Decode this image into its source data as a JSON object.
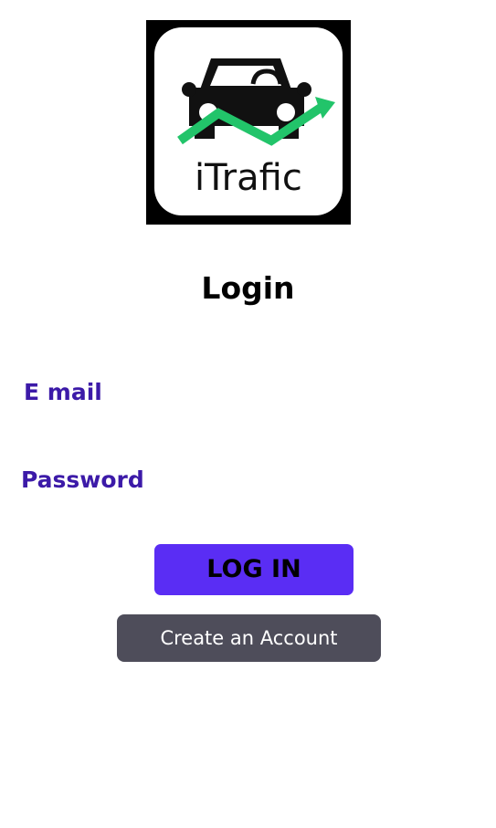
{
  "logo": {
    "text": "iTrafic",
    "car_color": "#111111",
    "arrow_color": "#22c46a"
  },
  "page_title": "Login",
  "form": {
    "email_label": "E mail",
    "email_value": "",
    "password_label": "Password",
    "password_value": "",
    "label_color": "#3c1aa8"
  },
  "buttons": {
    "login_label": "LOG IN",
    "login_color": "#5a2df4",
    "create_account_label": "Create an Account",
    "create_account_color": "#4e4d5a"
  }
}
